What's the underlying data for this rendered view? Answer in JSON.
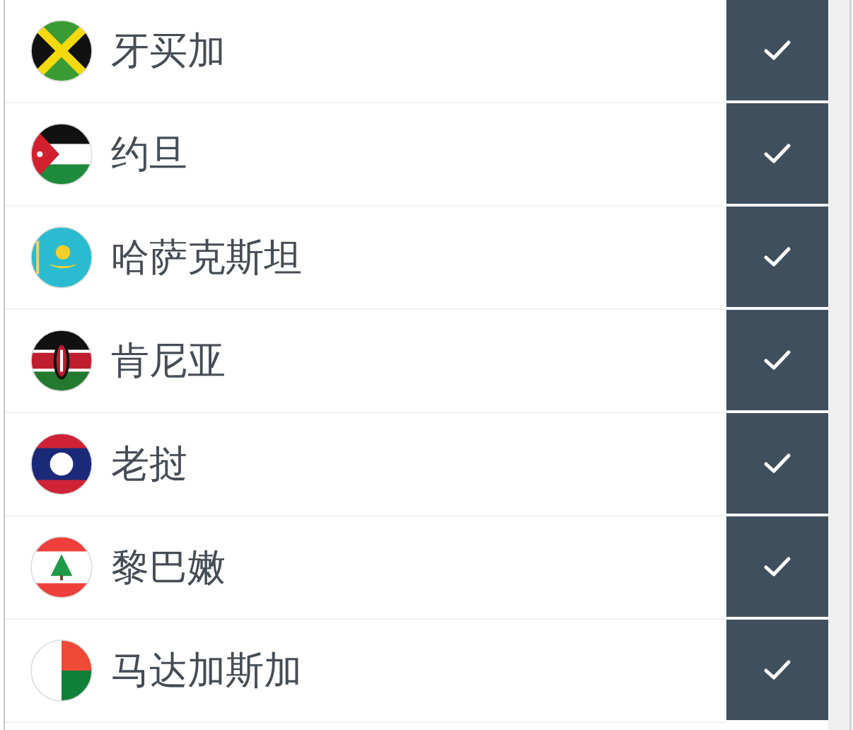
{
  "countries": [
    {
      "name": "牙买加",
      "kind": "jamaica",
      "checked": true
    },
    {
      "name": "约旦",
      "kind": "jordan",
      "checked": true
    },
    {
      "name": "哈萨克斯坦",
      "kind": "kazakhstan",
      "checked": true
    },
    {
      "name": "肯尼亚",
      "kind": "kenya",
      "checked": true
    },
    {
      "name": "老挝",
      "kind": "laos",
      "checked": true
    },
    {
      "name": "黎巴嫩",
      "kind": "lebanon",
      "checked": true
    },
    {
      "name": "马达加斯加",
      "kind": "madagascar",
      "checked": true
    }
  ]
}
